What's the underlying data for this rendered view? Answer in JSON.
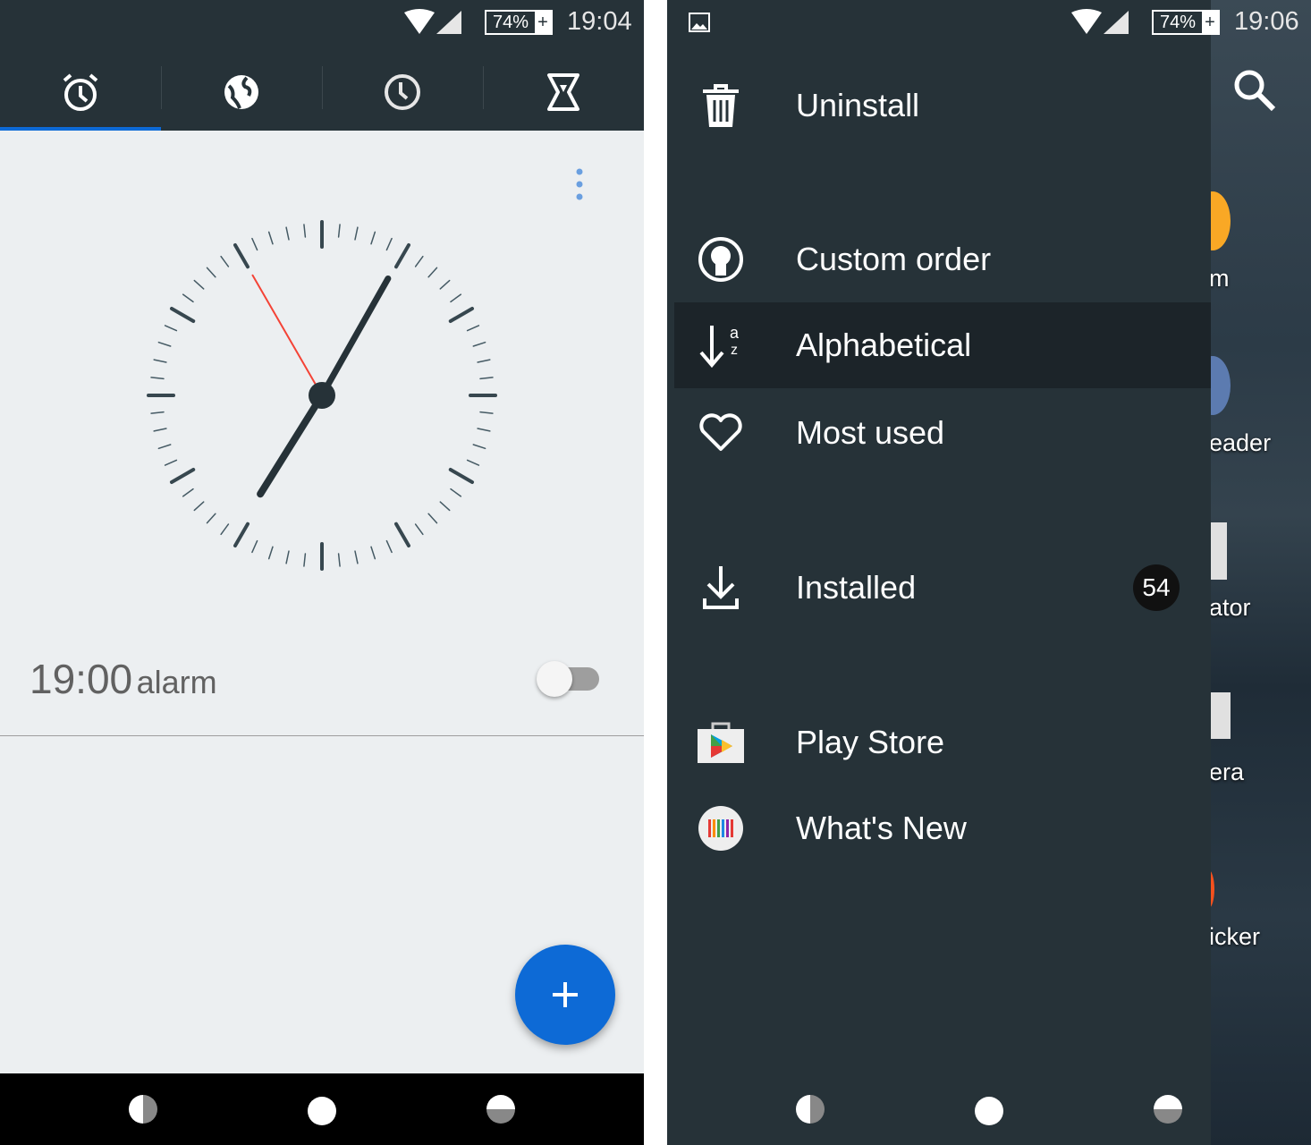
{
  "left": {
    "status": {
      "battery": "74%",
      "time": "19:04"
    },
    "tabs": [
      {
        "icon": "alarm-icon",
        "active": true
      },
      {
        "icon": "globe-icon",
        "active": false
      },
      {
        "icon": "clock-icon",
        "active": false
      },
      {
        "icon": "hourglass-icon",
        "active": false
      }
    ],
    "clock": {
      "hours": 7,
      "minutes": 4,
      "seconds": 55
    },
    "alarm": {
      "time": "19:00",
      "label": "alarm",
      "enabled": false
    },
    "fab_icon": "plus-icon",
    "colors": {
      "accent": "#0d6ad6",
      "second_hand": "#f44336",
      "appbar": "#263238"
    }
  },
  "right": {
    "status": {
      "battery": "74%",
      "time": "19:06"
    },
    "menu": [
      {
        "label": "Uninstall",
        "icon": "trash-icon"
      },
      {
        "label": "Custom order",
        "icon": "person-circle-icon"
      },
      {
        "label": "Alphabetical",
        "icon": "sort-alpha-icon",
        "selected": true
      },
      {
        "label": "Most used",
        "icon": "heart-icon"
      },
      {
        "label": "Installed",
        "icon": "download-icon",
        "badge": "54"
      },
      {
        "label": "Play Store",
        "icon": "play-store-icon"
      },
      {
        "label": "What's New",
        "icon": "whats-new-icon"
      }
    ],
    "background_apps": [
      "m",
      "eader",
      "ator",
      "era",
      "icker"
    ]
  }
}
